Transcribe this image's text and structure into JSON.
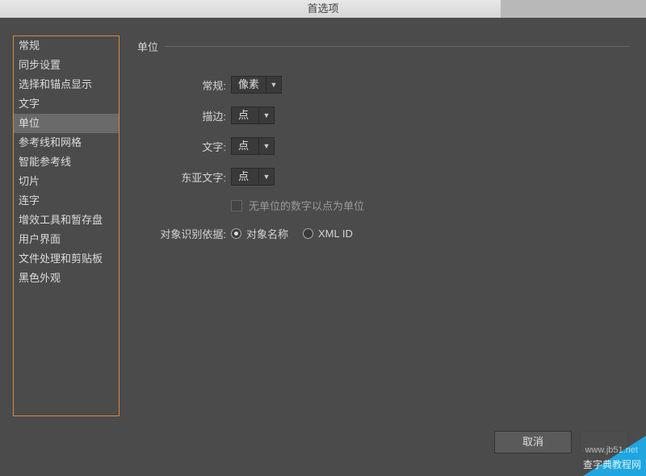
{
  "window": {
    "title": "首选项"
  },
  "sidebar": {
    "items": [
      {
        "label": "常规"
      },
      {
        "label": "同步设置"
      },
      {
        "label": "选择和锚点显示"
      },
      {
        "label": "文字"
      },
      {
        "label": "单位",
        "selected": true
      },
      {
        "label": "参考线和网格"
      },
      {
        "label": "智能参考线"
      },
      {
        "label": "切片"
      },
      {
        "label": "连字"
      },
      {
        "label": "增效工具和暂存盘"
      },
      {
        "label": "用户界面"
      },
      {
        "label": "文件处理和剪贴板"
      },
      {
        "label": "黑色外观"
      }
    ]
  },
  "panel": {
    "sectionTitle": "单位",
    "rows": {
      "general": {
        "label": "常规:",
        "value": "像素"
      },
      "stroke": {
        "label": "描边:",
        "value": "点"
      },
      "type": {
        "label": "文字:",
        "value": "点"
      },
      "asian": {
        "label": "东亚文字:",
        "value": "点"
      }
    },
    "noUnitCheckbox": {
      "label": "无单位的数字以点为单位",
      "checked": false
    },
    "identifyBy": {
      "label": "对象识别依据:",
      "options": [
        {
          "label": "对象名称",
          "checked": true
        },
        {
          "label": "XML ID",
          "checked": false
        }
      ]
    }
  },
  "buttons": {
    "cancel": "取消"
  },
  "watermark": {
    "line1": "www.jb51.net",
    "line2": "查字典教程网"
  }
}
